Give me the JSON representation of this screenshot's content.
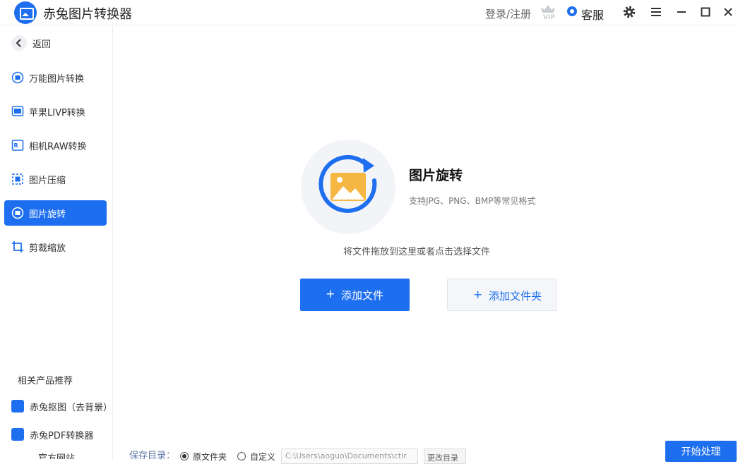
{
  "app": {
    "title": "赤兔图片转换器",
    "logo_icon": "image-converter-logo-icon"
  },
  "titlebar": {
    "login_label": "登录/注册",
    "vip_icon": "vip-crown-icon",
    "service_label": "客服",
    "buttons": [
      "gear-icon",
      "menu-icon",
      "minimize-icon",
      "maximize-icon",
      "close-icon"
    ]
  },
  "sidebar": {
    "back_label": "返回",
    "items": [
      {
        "label": "万能图片转换",
        "icon": "image-convert-icon",
        "active": false
      },
      {
        "label": "苹果LIVP转换",
        "icon": "livp-icon",
        "active": false
      },
      {
        "label": "相机RAW转换",
        "icon": "raw-icon",
        "active": false
      },
      {
        "label": "图片压缩",
        "icon": "compress-icon",
        "active": false
      },
      {
        "label": "图片旋转",
        "icon": "rotate-icon",
        "active": true
      },
      {
        "label": "剪裁缩放",
        "icon": "crop-icon",
        "active": false
      }
    ],
    "recommend_title": "相关产品推荐",
    "recommend_items": [
      {
        "label": "赤兔抠图（去背景）",
        "icon": "eraser-icon"
      },
      {
        "label": "赤兔PDF转换器",
        "icon": "pdf-icon"
      }
    ],
    "partial_item": "官方网站"
  },
  "main": {
    "feature_title": "图片旋转",
    "feature_subtitle": "支持JPG、PNG、BMP等常见格式",
    "drop_hint": "将文件拖放到这里或者点击选择文件",
    "add_file_label": "添加文件",
    "add_folder_label": "添加文件夹",
    "plus": "+"
  },
  "bottom": {
    "save_label": "保存目录：",
    "radio_original": "原文件夹",
    "radio_custom": "自定义",
    "selected": "原文件夹",
    "path_value": "C:\\Users\\aoguo\\Documents\\ctlr",
    "change_dir_label": "更改目录",
    "start_label": "开始处理"
  },
  "colors": {
    "accent": "#1e6ff0",
    "image_orange": "#f5b642"
  }
}
